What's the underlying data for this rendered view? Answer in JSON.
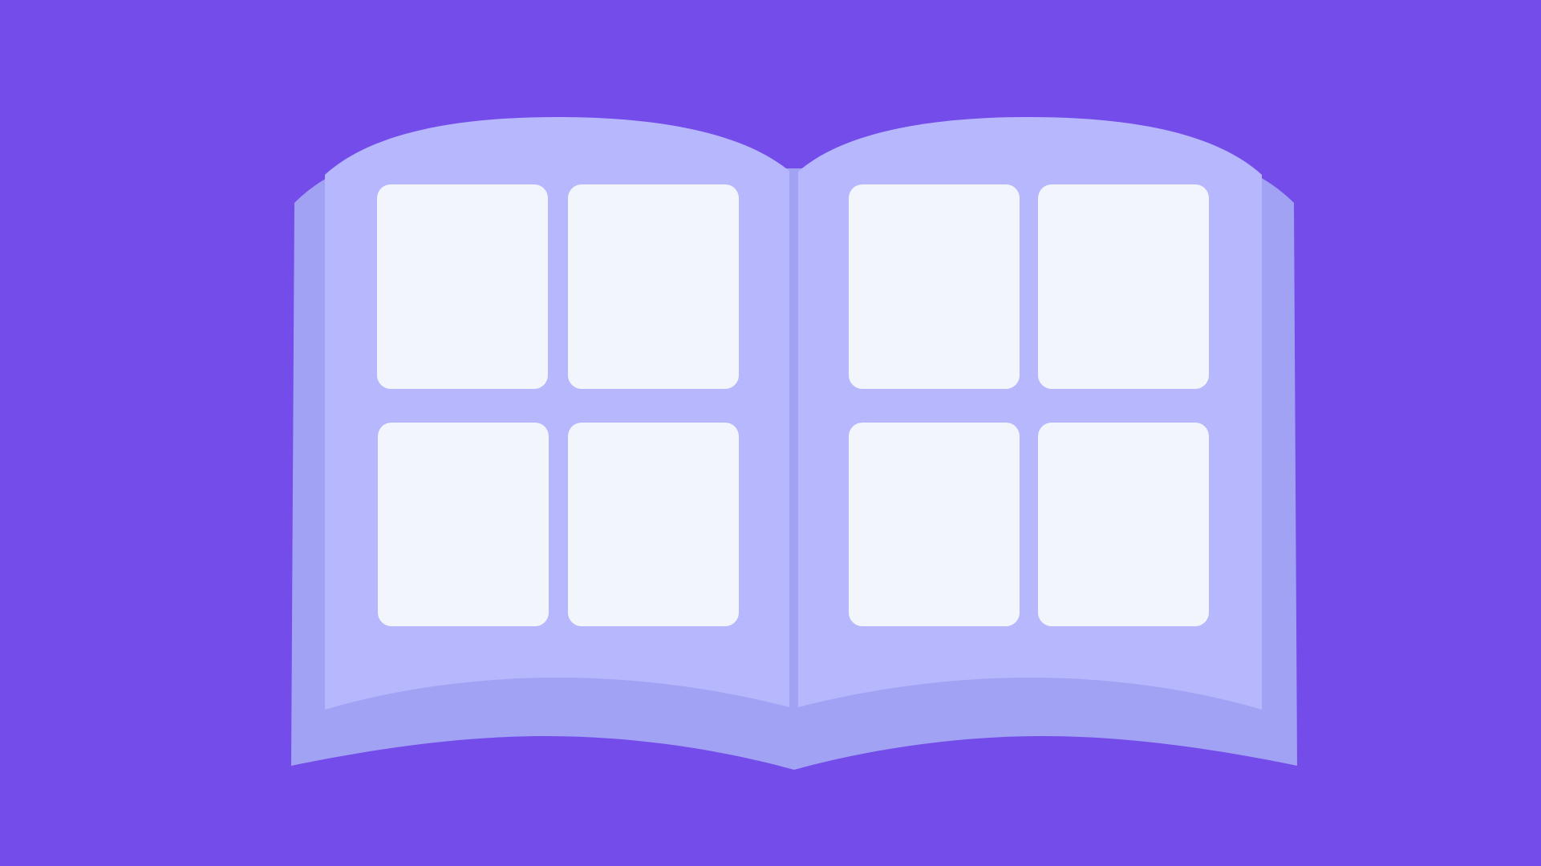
{
  "illustration": {
    "subject": "open-photo-album",
    "pages": [
      {
        "side": "left",
        "photo_slots": 4
      },
      {
        "side": "right",
        "photo_slots": 4
      }
    ]
  },
  "colors": {
    "background": "#734CEA",
    "cover": "#A2A2F4",
    "page": "#B7B7FD",
    "photo_slot": "#F3F5FD",
    "spine": "#A2A2F4"
  }
}
